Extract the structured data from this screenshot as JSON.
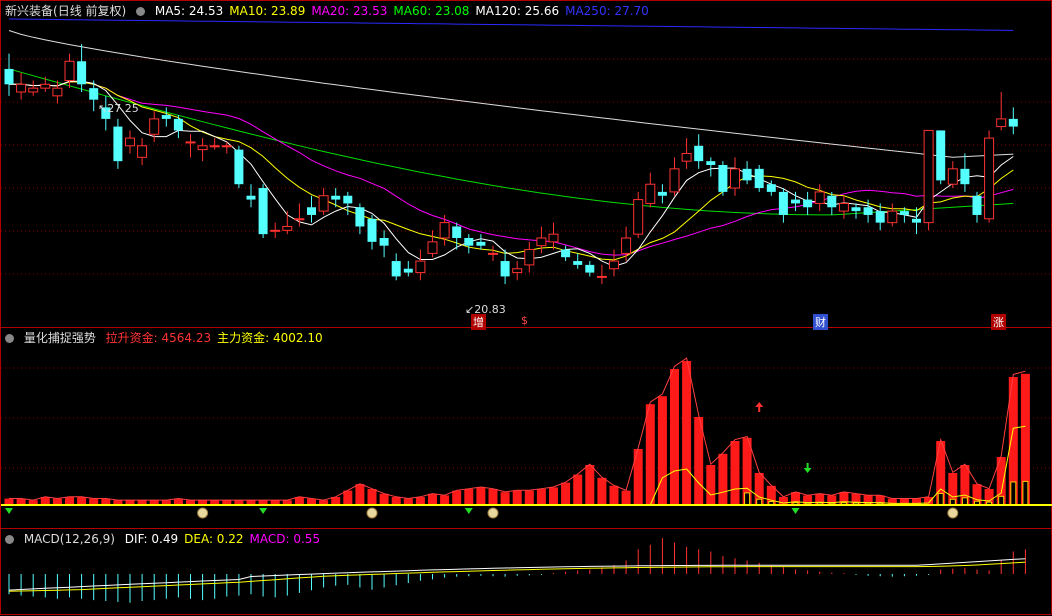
{
  "price_pane": {
    "stock_name": "新兴装备",
    "period_label": "(日线 前复权)",
    "ma_items": [
      {
        "label": "MA5: 24.53",
        "color": "#ffffff"
      },
      {
        "label": "MA10: 23.89",
        "color": "#ffff00"
      },
      {
        "label": "MA20: 23.53",
        "color": "#ff00ff"
      },
      {
        "label": "MA60: 23.08",
        "color": "#00ff00"
      },
      {
        "label": "MA120: 25.66",
        "color": "#ffffff"
      },
      {
        "label": "MA250: 27.70",
        "color": "#3333ff"
      }
    ],
    "high_label": "27.25",
    "low_label": "20.83",
    "events": [
      "增",
      "$",
      "财",
      "涨"
    ]
  },
  "indicator_pane": {
    "title": "量化捕捉强势",
    "items": [
      {
        "label": "拉升资金: 4564.23",
        "color": "#ff3333"
      },
      {
        "label": "主力资金: 4002.10",
        "color": "#ffff00"
      }
    ]
  },
  "macd_pane": {
    "title": "MACD(12,26,9)",
    "items": [
      {
        "label": "DIF: 0.49",
        "color": "#ffffff"
      },
      {
        "label": "DEA: 0.22",
        "color": "#ffff00"
      },
      {
        "label": "MACD: 0.55",
        "color": "#ff00ff"
      }
    ]
  },
  "colors": {
    "up": "#ff3232",
    "down": "#54ffff",
    "grid": "#8b0000"
  },
  "chart_data": {
    "type": "candlestick",
    "candles": [
      [
        26.6,
        26.2,
        27.0,
        25.9
      ],
      [
        26.0,
        26.2,
        26.5,
        25.8
      ],
      [
        26.0,
        26.1,
        26.3,
        25.9
      ],
      [
        26.1,
        26.2,
        26.4,
        26.0
      ],
      [
        25.9,
        26.1,
        26.3,
        25.7
      ],
      [
        26.3,
        26.8,
        27.0,
        26.1
      ],
      [
        26.8,
        26.2,
        27.25,
        26.0
      ],
      [
        26.1,
        25.8,
        26.3,
        25.5
      ],
      [
        25.6,
        25.3,
        25.9,
        25.0
      ],
      [
        25.1,
        24.2,
        25.3,
        24.0
      ],
      [
        24.6,
        24.8,
        25.0,
        24.4
      ],
      [
        24.3,
        24.6,
        24.8,
        24.1
      ],
      [
        24.9,
        25.3,
        25.5,
        24.7
      ],
      [
        25.4,
        25.3,
        25.6,
        25.1
      ],
      [
        25.3,
        25.0,
        25.4,
        24.8
      ],
      [
        24.7,
        24.7,
        24.9,
        24.3
      ],
      [
        24.5,
        24.6,
        24.8,
        24.2
      ],
      [
        24.6,
        24.6,
        24.8,
        24.5
      ],
      [
        24.6,
        24.6,
        24.7,
        24.4
      ],
      [
        24.5,
        23.6,
        24.6,
        23.5
      ],
      [
        23.3,
        23.2,
        23.6,
        23.0
      ],
      [
        23.5,
        22.3,
        23.6,
        22.2
      ],
      [
        22.4,
        22.4,
        22.6,
        22.2
      ],
      [
        22.4,
        22.5,
        22.9,
        22.3
      ],
      [
        22.7,
        22.7,
        23.1,
        22.5
      ],
      [
        23.0,
        22.8,
        23.3,
        22.6
      ],
      [
        22.9,
        23.3,
        23.5,
        22.8
      ],
      [
        23.3,
        23.2,
        23.5,
        23.0
      ],
      [
        23.3,
        23.1,
        23.4,
        22.8
      ],
      [
        23.0,
        22.5,
        23.1,
        22.3
      ],
      [
        22.7,
        22.1,
        22.8,
        21.9
      ],
      [
        22.2,
        22.0,
        22.4,
        21.7
      ],
      [
        21.6,
        21.2,
        21.8,
        21.1
      ],
      [
        21.4,
        21.3,
        21.6,
        21.2
      ],
      [
        21.3,
        21.6,
        21.9,
        21.1
      ],
      [
        21.8,
        22.1,
        22.4,
        21.7
      ],
      [
        22.2,
        22.6,
        22.8,
        22.0
      ],
      [
        22.5,
        22.2,
        22.6,
        21.9
      ],
      [
        22.2,
        22.0,
        22.3,
        21.8
      ],
      [
        22.1,
        22.0,
        22.3,
        21.9
      ],
      [
        21.8,
        21.8,
        22.0,
        21.6
      ],
      [
        21.6,
        21.2,
        21.9,
        21.0
      ],
      [
        21.3,
        21.4,
        21.6,
        21.1
      ],
      [
        21.5,
        21.9,
        22.1,
        21.3
      ],
      [
        22.0,
        22.2,
        22.5,
        21.8
      ],
      [
        22.1,
        22.3,
        22.6,
        21.9
      ],
      [
        21.9,
        21.7,
        22.0,
        21.6
      ],
      [
        21.6,
        21.5,
        21.8,
        21.4
      ],
      [
        21.5,
        21.3,
        21.6,
        21.2
      ],
      [
        21.2,
        21.2,
        21.5,
        21.0
      ],
      [
        21.4,
        21.6,
        21.9,
        21.2
      ],
      [
        21.8,
        22.2,
        22.5,
        21.6
      ],
      [
        22.3,
        23.2,
        23.4,
        22.2
      ],
      [
        23.1,
        23.6,
        23.9,
        23.0
      ],
      [
        23.4,
        23.3,
        23.6,
        23.1
      ],
      [
        23.4,
        24.0,
        24.3,
        23.3
      ],
      [
        24.2,
        24.4,
        24.8,
        24.0
      ],
      [
        24.6,
        24.2,
        24.9,
        24.0
      ],
      [
        24.2,
        24.1,
        24.3,
        23.8
      ],
      [
        24.1,
        23.4,
        24.2,
        23.3
      ],
      [
        23.5,
        24.0,
        24.3,
        23.3
      ],
      [
        24.0,
        23.7,
        24.2,
        23.6
      ],
      [
        24.0,
        23.5,
        24.1,
        23.4
      ],
      [
        23.6,
        23.4,
        23.7,
        23.3
      ],
      [
        23.4,
        22.8,
        23.5,
        22.6
      ],
      [
        23.2,
        23.1,
        23.4,
        22.9
      ],
      [
        23.2,
        23.0,
        23.4,
        22.8
      ],
      [
        23.1,
        23.4,
        23.6,
        22.9
      ],
      [
        23.3,
        23.0,
        23.4,
        22.8
      ],
      [
        22.9,
        23.1,
        23.3,
        22.7
      ],
      [
        23.0,
        22.9,
        23.1,
        22.7
      ],
      [
        23.0,
        22.8,
        23.2,
        22.6
      ],
      [
        22.9,
        22.6,
        23.1,
        22.4
      ],
      [
        22.6,
        22.9,
        23.1,
        22.5
      ],
      [
        22.9,
        22.8,
        23.0,
        22.6
      ],
      [
        22.7,
        22.6,
        23.0,
        22.3
      ],
      [
        22.6,
        25.0,
        25.0,
        22.4
      ],
      [
        25.0,
        23.7,
        25.0,
        23.6
      ],
      [
        23.6,
        24.0,
        24.2,
        23.5
      ],
      [
        24.0,
        23.6,
        24.4,
        23.4
      ],
      [
        23.3,
        22.8,
        23.4,
        22.6
      ],
      [
        22.7,
        24.8,
        25.0,
        22.6
      ],
      [
        25.1,
        25.3,
        26.0,
        25.0
      ],
      [
        25.3,
        25.1,
        25.6,
        24.9
      ]
    ],
    "volume_red": [
      0.04,
      0.04,
      0.03,
      0.05,
      0.04,
      0.05,
      0.05,
      0.04,
      0.04,
      0.03,
      0.03,
      0.03,
      0.03,
      0.03,
      0.04,
      0.03,
      0.03,
      0.03,
      0.03,
      0.03,
      0.03,
      0.03,
      0.03,
      0.03,
      0.05,
      0.04,
      0.03,
      0.05,
      0.09,
      0.13,
      0.1,
      0.07,
      0.05,
      0.04,
      0.05,
      0.07,
      0.06,
      0.09,
      0.1,
      0.11,
      0.1,
      0.08,
      0.09,
      0.09,
      0.1,
      0.11,
      0.14,
      0.19,
      0.25,
      0.17,
      0.12,
      0.09,
      0.35,
      0.63,
      0.68,
      0.85,
      0.9,
      0.55,
      0.25,
      0.32,
      0.4,
      0.42,
      0.2,
      0.12,
      0.05,
      0.08,
      0.06,
      0.07,
      0.06,
      0.08,
      0.07,
      0.06,
      0.06,
      0.04,
      0.04,
      0.04,
      0.05,
      0.4,
      0.2,
      0.25,
      0.13,
      0.1,
      0.3,
      0.8,
      0.82
    ],
    "macd_hist": [
      -0.45,
      -0.48,
      -0.5,
      -0.52,
      -0.55,
      -0.52,
      -0.55,
      -0.58,
      -0.6,
      -0.62,
      -0.64,
      -0.6,
      -0.58,
      -0.55,
      -0.52,
      -0.55,
      -0.58,
      -0.55,
      -0.5,
      -0.48,
      -0.45,
      -0.5,
      -0.52,
      -0.48,
      -0.42,
      -0.36,
      -0.3,
      -0.26,
      -0.24,
      -0.3,
      -0.35,
      -0.3,
      -0.25,
      -0.2,
      -0.15,
      -0.12,
      -0.08,
      -0.06,
      -0.05,
      -0.04,
      -0.05,
      -0.06,
      -0.04,
      -0.03,
      -0.02,
      0.02,
      0.05,
      0.08,
      0.1,
      0.15,
      0.2,
      0.3,
      0.55,
      0.65,
      0.8,
      0.7,
      0.6,
      0.55,
      0.5,
      0.4,
      0.35,
      0.3,
      0.25,
      0.2,
      0.15,
      0.1,
      0.08,
      0.05,
      0.03,
      0.02,
      -0.02,
      -0.04,
      -0.05,
      -0.06,
      -0.05,
      -0.04,
      -0.02,
      0.1,
      0.12,
      0.14,
      0.1,
      0.08,
      0.3,
      0.5,
      0.55
    ]
  }
}
